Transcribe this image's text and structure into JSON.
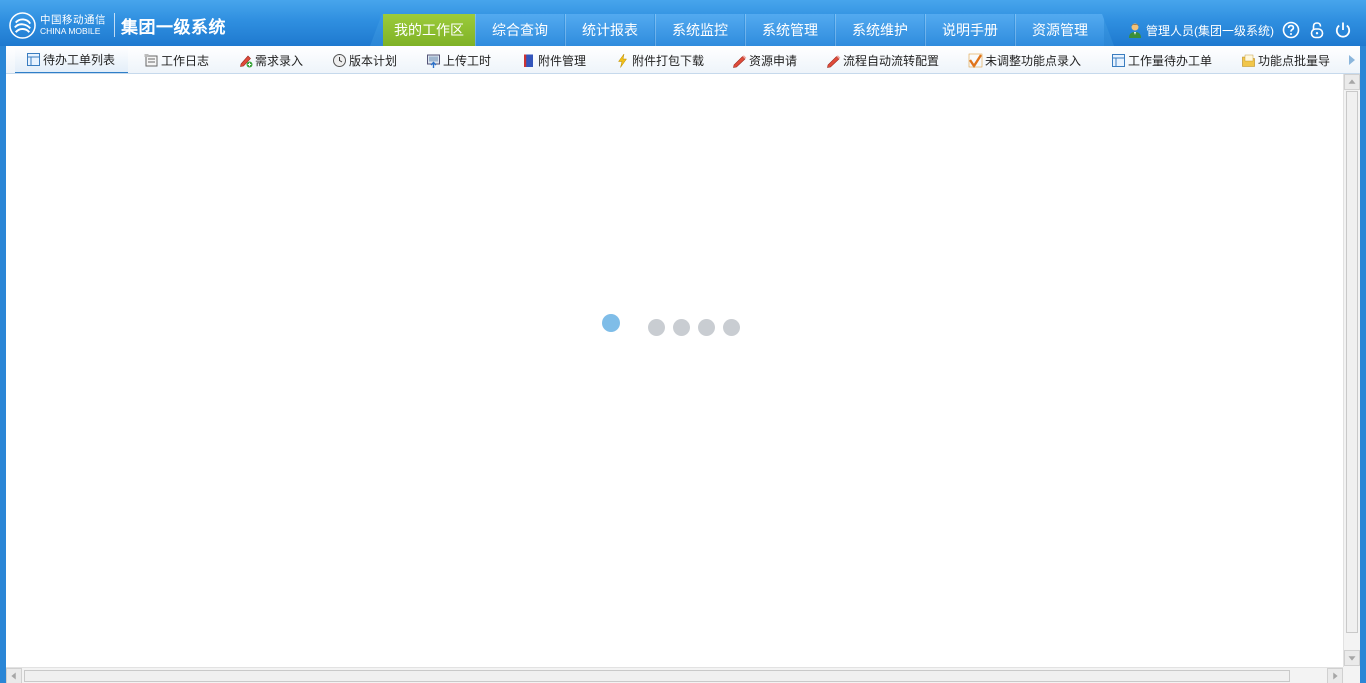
{
  "brand": {
    "logo_cn": "中国移动通信",
    "logo_en": "CHINA MOBILE",
    "system_name": "集团一级系统"
  },
  "nav": {
    "active_index": 0,
    "tabs": [
      {
        "label": "我的工作区"
      },
      {
        "label": "综合查询"
      },
      {
        "label": "统计报表"
      },
      {
        "label": "系统监控"
      },
      {
        "label": "系统管理"
      },
      {
        "label": "系统维护"
      },
      {
        "label": "说明手册"
      },
      {
        "label": "资源管理"
      }
    ]
  },
  "user": {
    "label": "管理人员(集团一级系统)",
    "icons": [
      "user-icon",
      "help-icon",
      "lock-icon",
      "power-icon"
    ]
  },
  "toolbar": {
    "active_index": 0,
    "items": [
      {
        "label": "待办工单列表",
        "icon": "list-icon"
      },
      {
        "label": "工作日志",
        "icon": "log-icon"
      },
      {
        "label": "需求录入",
        "icon": "pencil-add-icon"
      },
      {
        "label": "版本计划",
        "icon": "clock-icon"
      },
      {
        "label": "上传工时",
        "icon": "upload-icon"
      },
      {
        "label": "附件管理",
        "icon": "book-icon"
      },
      {
        "label": "附件打包下载",
        "icon": "lightning-icon"
      },
      {
        "label": "资源申请",
        "icon": "pencil-icon"
      },
      {
        "label": "流程自动流转配置",
        "icon": "pencil-icon"
      },
      {
        "label": "未调整功能点录入",
        "icon": "check-icon"
      },
      {
        "label": "工作量待办工单",
        "icon": "list-icon"
      },
      {
        "label": "功能点批量导",
        "icon": "folder-icon"
      }
    ]
  },
  "loader": {
    "state": "loading",
    "dot_count": 5,
    "active_dot": 0,
    "colors": {
      "active": "#7fbde8",
      "inactive": "#c9cdd2"
    }
  },
  "colors": {
    "header": "#2f8fe0",
    "active_tab": "#8cbd2f",
    "toolbar_accent": "#2f7fc8"
  }
}
